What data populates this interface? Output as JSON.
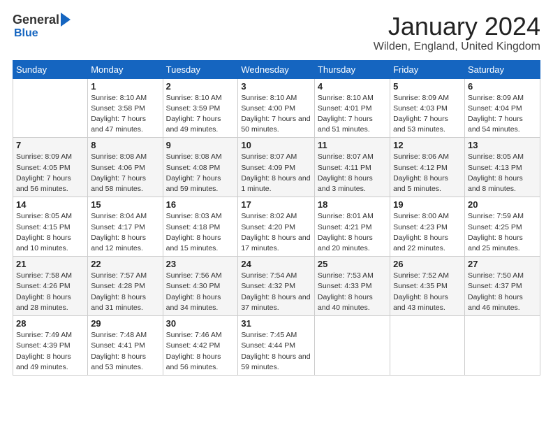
{
  "header": {
    "logo": {
      "general": "General",
      "blue": "Blue"
    },
    "title": "January 2024",
    "subtitle": "Wilden, England, United Kingdom"
  },
  "weekdays": [
    "Sunday",
    "Monday",
    "Tuesday",
    "Wednesday",
    "Thursday",
    "Friday",
    "Saturday"
  ],
  "weeks": [
    [
      {
        "day": "",
        "sunrise": "",
        "sunset": "",
        "daylight": ""
      },
      {
        "day": "1",
        "sunrise": "Sunrise: 8:10 AM",
        "sunset": "Sunset: 3:58 PM",
        "daylight": "Daylight: 7 hours and 47 minutes."
      },
      {
        "day": "2",
        "sunrise": "Sunrise: 8:10 AM",
        "sunset": "Sunset: 3:59 PM",
        "daylight": "Daylight: 7 hours and 49 minutes."
      },
      {
        "day": "3",
        "sunrise": "Sunrise: 8:10 AM",
        "sunset": "Sunset: 4:00 PM",
        "daylight": "Daylight: 7 hours and 50 minutes."
      },
      {
        "day": "4",
        "sunrise": "Sunrise: 8:10 AM",
        "sunset": "Sunset: 4:01 PM",
        "daylight": "Daylight: 7 hours and 51 minutes."
      },
      {
        "day": "5",
        "sunrise": "Sunrise: 8:09 AM",
        "sunset": "Sunset: 4:03 PM",
        "daylight": "Daylight: 7 hours and 53 minutes."
      },
      {
        "day": "6",
        "sunrise": "Sunrise: 8:09 AM",
        "sunset": "Sunset: 4:04 PM",
        "daylight": "Daylight: 7 hours and 54 minutes."
      }
    ],
    [
      {
        "day": "7",
        "sunrise": "Sunrise: 8:09 AM",
        "sunset": "Sunset: 4:05 PM",
        "daylight": "Daylight: 7 hours and 56 minutes."
      },
      {
        "day": "8",
        "sunrise": "Sunrise: 8:08 AM",
        "sunset": "Sunset: 4:06 PM",
        "daylight": "Daylight: 7 hours and 58 minutes."
      },
      {
        "day": "9",
        "sunrise": "Sunrise: 8:08 AM",
        "sunset": "Sunset: 4:08 PM",
        "daylight": "Daylight: 7 hours and 59 minutes."
      },
      {
        "day": "10",
        "sunrise": "Sunrise: 8:07 AM",
        "sunset": "Sunset: 4:09 PM",
        "daylight": "Daylight: 8 hours and 1 minute."
      },
      {
        "day": "11",
        "sunrise": "Sunrise: 8:07 AM",
        "sunset": "Sunset: 4:11 PM",
        "daylight": "Daylight: 8 hours and 3 minutes."
      },
      {
        "day": "12",
        "sunrise": "Sunrise: 8:06 AM",
        "sunset": "Sunset: 4:12 PM",
        "daylight": "Daylight: 8 hours and 5 minutes."
      },
      {
        "day": "13",
        "sunrise": "Sunrise: 8:05 AM",
        "sunset": "Sunset: 4:13 PM",
        "daylight": "Daylight: 8 hours and 8 minutes."
      }
    ],
    [
      {
        "day": "14",
        "sunrise": "Sunrise: 8:05 AM",
        "sunset": "Sunset: 4:15 PM",
        "daylight": "Daylight: 8 hours and 10 minutes."
      },
      {
        "day": "15",
        "sunrise": "Sunrise: 8:04 AM",
        "sunset": "Sunset: 4:17 PM",
        "daylight": "Daylight: 8 hours and 12 minutes."
      },
      {
        "day": "16",
        "sunrise": "Sunrise: 8:03 AM",
        "sunset": "Sunset: 4:18 PM",
        "daylight": "Daylight: 8 hours and 15 minutes."
      },
      {
        "day": "17",
        "sunrise": "Sunrise: 8:02 AM",
        "sunset": "Sunset: 4:20 PM",
        "daylight": "Daylight: 8 hours and 17 minutes."
      },
      {
        "day": "18",
        "sunrise": "Sunrise: 8:01 AM",
        "sunset": "Sunset: 4:21 PM",
        "daylight": "Daylight: 8 hours and 20 minutes."
      },
      {
        "day": "19",
        "sunrise": "Sunrise: 8:00 AM",
        "sunset": "Sunset: 4:23 PM",
        "daylight": "Daylight: 8 hours and 22 minutes."
      },
      {
        "day": "20",
        "sunrise": "Sunrise: 7:59 AM",
        "sunset": "Sunset: 4:25 PM",
        "daylight": "Daylight: 8 hours and 25 minutes."
      }
    ],
    [
      {
        "day": "21",
        "sunrise": "Sunrise: 7:58 AM",
        "sunset": "Sunset: 4:26 PM",
        "daylight": "Daylight: 8 hours and 28 minutes."
      },
      {
        "day": "22",
        "sunrise": "Sunrise: 7:57 AM",
        "sunset": "Sunset: 4:28 PM",
        "daylight": "Daylight: 8 hours and 31 minutes."
      },
      {
        "day": "23",
        "sunrise": "Sunrise: 7:56 AM",
        "sunset": "Sunset: 4:30 PM",
        "daylight": "Daylight: 8 hours and 34 minutes."
      },
      {
        "day": "24",
        "sunrise": "Sunrise: 7:54 AM",
        "sunset": "Sunset: 4:32 PM",
        "daylight": "Daylight: 8 hours and 37 minutes."
      },
      {
        "day": "25",
        "sunrise": "Sunrise: 7:53 AM",
        "sunset": "Sunset: 4:33 PM",
        "daylight": "Daylight: 8 hours and 40 minutes."
      },
      {
        "day": "26",
        "sunrise": "Sunrise: 7:52 AM",
        "sunset": "Sunset: 4:35 PM",
        "daylight": "Daylight: 8 hours and 43 minutes."
      },
      {
        "day": "27",
        "sunrise": "Sunrise: 7:50 AM",
        "sunset": "Sunset: 4:37 PM",
        "daylight": "Daylight: 8 hours and 46 minutes."
      }
    ],
    [
      {
        "day": "28",
        "sunrise": "Sunrise: 7:49 AM",
        "sunset": "Sunset: 4:39 PM",
        "daylight": "Daylight: 8 hours and 49 minutes."
      },
      {
        "day": "29",
        "sunrise": "Sunrise: 7:48 AM",
        "sunset": "Sunset: 4:41 PM",
        "daylight": "Daylight: 8 hours and 53 minutes."
      },
      {
        "day": "30",
        "sunrise": "Sunrise: 7:46 AM",
        "sunset": "Sunset: 4:42 PM",
        "daylight": "Daylight: 8 hours and 56 minutes."
      },
      {
        "day": "31",
        "sunrise": "Sunrise: 7:45 AM",
        "sunset": "Sunset: 4:44 PM",
        "daylight": "Daylight: 8 hours and 59 minutes."
      },
      {
        "day": "",
        "sunrise": "",
        "sunset": "",
        "daylight": ""
      },
      {
        "day": "",
        "sunrise": "",
        "sunset": "",
        "daylight": ""
      },
      {
        "day": "",
        "sunrise": "",
        "sunset": "",
        "daylight": ""
      }
    ]
  ]
}
